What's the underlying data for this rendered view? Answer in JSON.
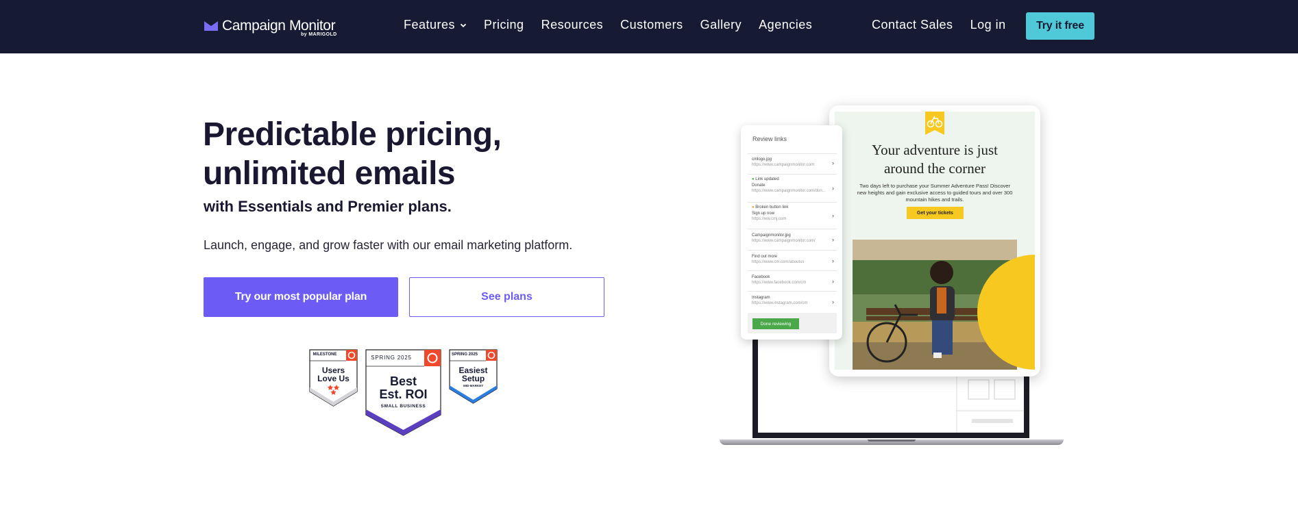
{
  "nav": {
    "logo_text": "Campaign Monitor",
    "logo_sub": "by MARIGOLD",
    "links": [
      {
        "label": "Features"
      },
      {
        "label": "Pricing"
      },
      {
        "label": "Resources"
      },
      {
        "label": "Customers"
      },
      {
        "label": "Gallery"
      },
      {
        "label": "Agencies"
      }
    ],
    "contact_sales": "Contact Sales",
    "login": "Log in",
    "try_free": "Try it free"
  },
  "hero": {
    "title_line1": "Predictable pricing,",
    "title_line2": "unlimited emails",
    "subtitle": "with Essentials and Premier plans.",
    "lead": "Launch, engage, and grow faster with our email marketing platform.",
    "primary_cta": "Try our most popular plan",
    "secondary_cta": "See plans"
  },
  "badges": [
    {
      "top": "MILESTONE",
      "line1": "Users",
      "line2": "Love Us",
      "bottom": ""
    },
    {
      "top": "SPRING 2025",
      "line1": "Best",
      "line2": "Est. ROI",
      "bottom": "SMALL BUSINESS"
    },
    {
      "top": "SPRING 2025",
      "line1": "Easiest",
      "line2": "Setup",
      "bottom": "MID-MARKET"
    }
  ],
  "badge_logo": "G2",
  "email_preview": {
    "title_line1": "Your adventure is just",
    "title_line2": "around the corner",
    "body": "Two days left to purchase your Summer Adventure Pass! Discover new heights and gain exclusive access to guided tours and over 300 mountain hikes and trails.",
    "button": "Get your tickets"
  },
  "review_panel": {
    "title": "Review links",
    "rows": [
      {
        "status": "",
        "name": "cmlogo.jpg",
        "url": "https://www.campaignmonitor.com"
      },
      {
        "status": "Link updated",
        "name": "Donate",
        "url": "https://www.campaignmonitor.com/don..."
      },
      {
        "status": "Broken button link",
        "name": "Sign up now",
        "url": "https://ww.cmj.com"
      },
      {
        "status": "",
        "name": "Campaignmonitor.jpg",
        "url": "https://www.campaignmonitor.com/"
      },
      {
        "status": "",
        "name": "Find out more",
        "url": "https://www.cm.com/aboutus"
      },
      {
        "status": "",
        "name": "Facebook",
        "url": "https://www.facebook.com/cm"
      },
      {
        "status": "",
        "name": "Instagram",
        "url": "https://www.instagram.com/cm"
      }
    ],
    "done_button": "Done reviewing"
  },
  "colors": {
    "nav_bg": "#161a33",
    "accent": "#6c5cf5",
    "try_btn": "#4fc8d8",
    "yellow": "#f7c920",
    "g2_red": "#ef492d"
  }
}
